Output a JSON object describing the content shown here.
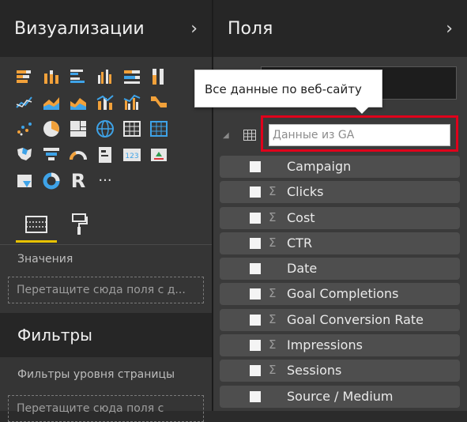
{
  "visualizations": {
    "title": "Визуализации",
    "chevron": "›",
    "gallery": [
      [
        "stacked-bar-icon",
        "stacked-column-icon",
        "clustered-bar-icon",
        "clustered-column-icon",
        "100-bar-icon",
        "100-column-icon"
      ],
      [
        "line-chart-icon",
        "area-chart-icon",
        "stacked-area-icon",
        "line-column-icon",
        "line-clustered-icon",
        "ribbon-icon"
      ],
      [
        "scatter-icon",
        "pie-chart-icon",
        "treemap-icon",
        "map-icon",
        "table-icon",
        "matrix-icon"
      ],
      [
        "filled-map-icon",
        "funnel-icon",
        "gauge-icon",
        "card-icon",
        "multirow-card-icon",
        "kpi-icon"
      ],
      [
        "slicer-icon",
        "donut-icon",
        "r-visual-icon",
        "more-visuals-icon"
      ]
    ],
    "r_label": "R",
    "more_label": "···"
  },
  "pane": {
    "values_label": "Значения",
    "values_drop": "Перетащите сюда поля с д...",
    "filters_title": "Фильтры",
    "page_filters_label": "Фильтры уровня страницы",
    "page_filters_drop": "Перетащите сюда поля с"
  },
  "fields_pane": {
    "title": "Поля",
    "chevron": "›",
    "tooltip": "Все данные по веб-сайту",
    "table_name": "Данные из GA",
    "fields": [
      {
        "name": "Campaign",
        "sigma": ""
      },
      {
        "name": "Clicks",
        "sigma": "Σ"
      },
      {
        "name": "Cost",
        "sigma": "Σ"
      },
      {
        "name": "CTR",
        "sigma": "Σ"
      },
      {
        "name": "Date",
        "sigma": ""
      },
      {
        "name": "Goal Completions",
        "sigma": "Σ"
      },
      {
        "name": "Goal Conversion Rate",
        "sigma": "Σ"
      },
      {
        "name": "Impressions",
        "sigma": "Σ"
      },
      {
        "name": "Sessions",
        "sigma": "Σ"
      },
      {
        "name": "Source / Medium",
        "sigma": ""
      }
    ]
  },
  "colors": {
    "accent_yellow": "#e8c200",
    "highlight_red": "#e0001b",
    "icon_orange": "#f2a13a",
    "icon_blue": "#3ea3e8",
    "icon_white": "#e6e6e6"
  }
}
